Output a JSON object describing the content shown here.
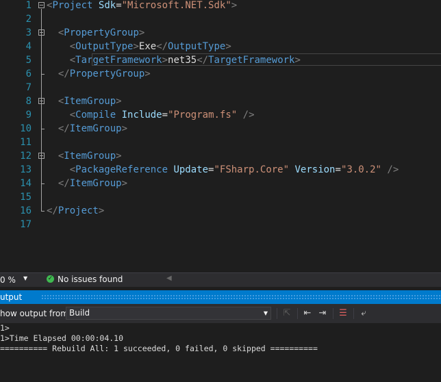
{
  "editor": {
    "lines": [
      {
        "n": "1",
        "parts": [
          [
            "b",
            "<"
          ],
          [
            "t",
            "Project"
          ],
          [
            "x",
            " "
          ],
          [
            "a",
            "Sdk"
          ],
          [
            "x",
            "="
          ],
          [
            "v",
            "\"Microsoft.NET.Sdk\""
          ],
          [
            "b",
            ">"
          ]
        ]
      },
      {
        "n": "2",
        "parts": []
      },
      {
        "n": "3",
        "parts": [
          [
            "x",
            "  "
          ],
          [
            "b",
            "<"
          ],
          [
            "t",
            "PropertyGroup"
          ],
          [
            "b",
            ">"
          ]
        ]
      },
      {
        "n": "4",
        "parts": [
          [
            "x",
            "    "
          ],
          [
            "b",
            "<"
          ],
          [
            "t",
            "OutputType"
          ],
          [
            "b",
            ">"
          ],
          [
            "x",
            "Exe"
          ],
          [
            "b",
            "</"
          ],
          [
            "t",
            "OutputType"
          ],
          [
            "b",
            ">"
          ]
        ]
      },
      {
        "n": "5",
        "parts": [
          [
            "x",
            "    "
          ],
          [
            "b",
            "<"
          ],
          [
            "t",
            "TargetFramework"
          ],
          [
            "b",
            ">"
          ],
          [
            "x",
            "net35"
          ],
          [
            "b",
            "</"
          ],
          [
            "t",
            "TargetFramework"
          ],
          [
            "b",
            ">"
          ]
        ]
      },
      {
        "n": "6",
        "parts": [
          [
            "x",
            "  "
          ],
          [
            "b",
            "</"
          ],
          [
            "t",
            "PropertyGroup"
          ],
          [
            "b",
            ">"
          ]
        ]
      },
      {
        "n": "7",
        "parts": []
      },
      {
        "n": "8",
        "parts": [
          [
            "x",
            "  "
          ],
          [
            "b",
            "<"
          ],
          [
            "t",
            "ItemGroup"
          ],
          [
            "b",
            ">"
          ]
        ]
      },
      {
        "n": "9",
        "parts": [
          [
            "x",
            "    "
          ],
          [
            "b",
            "<"
          ],
          [
            "t",
            "Compile"
          ],
          [
            "x",
            " "
          ],
          [
            "a",
            "Include"
          ],
          [
            "x",
            "="
          ],
          [
            "v",
            "\"Program.fs\""
          ],
          [
            "x",
            " "
          ],
          [
            "b",
            "/>"
          ]
        ]
      },
      {
        "n": "10",
        "parts": [
          [
            "x",
            "  "
          ],
          [
            "b",
            "</"
          ],
          [
            "t",
            "ItemGroup"
          ],
          [
            "b",
            ">"
          ]
        ]
      },
      {
        "n": "11",
        "parts": []
      },
      {
        "n": "12",
        "parts": [
          [
            "x",
            "  "
          ],
          [
            "b",
            "<"
          ],
          [
            "t",
            "ItemGroup"
          ],
          [
            "b",
            ">"
          ]
        ]
      },
      {
        "n": "13",
        "parts": [
          [
            "x",
            "    "
          ],
          [
            "b",
            "<"
          ],
          [
            "t",
            "PackageReference"
          ],
          [
            "x",
            " "
          ],
          [
            "a",
            "Update"
          ],
          [
            "x",
            "="
          ],
          [
            "v",
            "\"FSharp.Core\""
          ],
          [
            "x",
            " "
          ],
          [
            "a",
            "Version"
          ],
          [
            "x",
            "="
          ],
          [
            "v",
            "\"3.0.2\""
          ],
          [
            "x",
            " "
          ],
          [
            "b",
            "/>"
          ]
        ]
      },
      {
        "n": "14",
        "parts": [
          [
            "x",
            "  "
          ],
          [
            "b",
            "</"
          ],
          [
            "t",
            "ItemGroup"
          ],
          [
            "b",
            ">"
          ]
        ]
      },
      {
        "n": "15",
        "parts": []
      },
      {
        "n": "16",
        "parts": [
          [
            "b",
            "</"
          ],
          [
            "t",
            "Project"
          ],
          [
            "b",
            ">"
          ]
        ]
      },
      {
        "n": "17",
        "parts": []
      }
    ],
    "current_line": "5",
    "colors": {
      "bracket": "#808080",
      "tag": "#569cd6",
      "attr": "#9cdcfe",
      "value": "#ce9178",
      "text": "#dcdcdc",
      "line_number": "#2b91af"
    }
  },
  "status": {
    "zoom": "0 %",
    "issues": "No issues found"
  },
  "output": {
    "title": "utput",
    "show_from_label": "how output from:",
    "source": "Build",
    "lines": [
      "1>",
      "1>Time Elapsed 00:00:04.10",
      "========== Rebuild All: 1 succeeded, 0 failed, 0 skipped =========="
    ]
  }
}
